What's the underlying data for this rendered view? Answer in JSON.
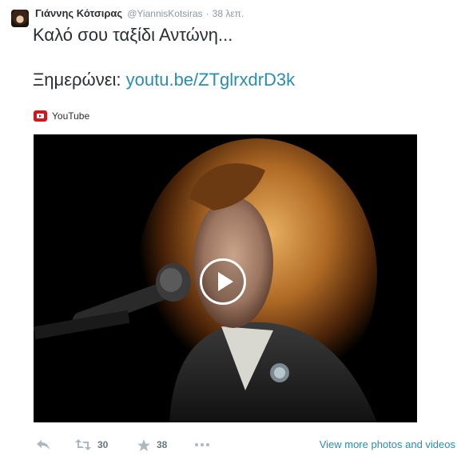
{
  "tweet": {
    "fullname": "Γιάννης Κότσιρας",
    "username": "@YiannisKotsiras",
    "separator": "·",
    "timestamp": "38 λεπ.",
    "text_line1": "Καλό σου ταξίδι Αντώνη...",
    "text_line2_prefix": "Ξημερώνει: ",
    "text_link": "youtu.be/ZTglrxdrD3k"
  },
  "card": {
    "source_icon": "youtube-icon",
    "source_label": "YouTube"
  },
  "actions": {
    "reply_icon": "reply-icon",
    "retweet_icon": "retweet-icon",
    "retweet_count": "30",
    "favorite_icon": "star-icon",
    "favorite_count": "38",
    "more_icon": "more-icon",
    "view_more_label": "View more photos and videos"
  },
  "colors": {
    "link": "#2b8dae",
    "muted": "#8899a6",
    "text": "#292f33",
    "youtube_red": "#cc181e"
  }
}
